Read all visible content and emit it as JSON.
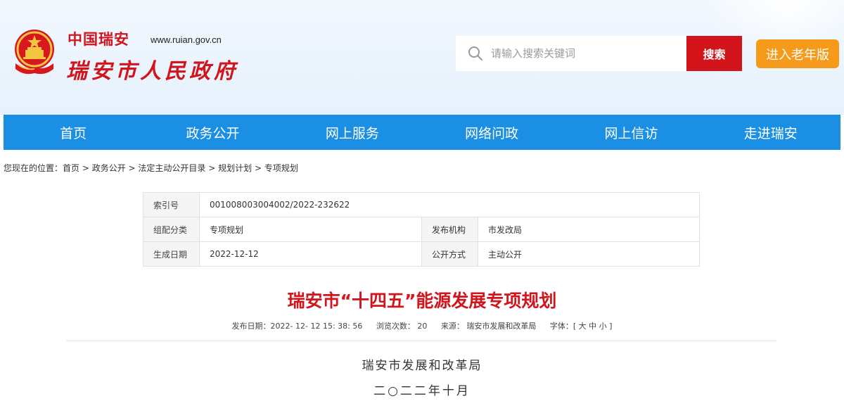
{
  "header": {
    "title_small": "中国瑞安",
    "site_url": "www.ruian.gov.cn",
    "title_big": "瑞安市人民政府",
    "emblem_icon": "national-emblem-icon",
    "colors": {
      "brand_red": "#d1151c",
      "nav_blue": "#1a8fe3",
      "elder_orange": "#f59a1b"
    }
  },
  "search": {
    "placeholder": "请输入搜索关键词",
    "button_label": "搜索"
  },
  "elder_mode_label": "进入老年版",
  "nav": {
    "items": [
      "首页",
      "政务公开",
      "网上服务",
      "网络问政",
      "网上信访",
      "走进瑞安"
    ]
  },
  "breadcrumb": {
    "prefix": "您现在的位置：",
    "items": [
      "首页",
      "政务公开",
      "法定主动公开目录",
      "规划计划",
      "专项规划"
    ],
    "separator": " > "
  },
  "info": {
    "index_label": "索引号",
    "index_value": "001008003004002/2022-232622",
    "category_label": "组配分类",
    "category_value": "专项规划",
    "publisher_label": "发布机构",
    "publisher_value": "市发改局",
    "date_label": "生成日期",
    "date_value": "2022-12-12",
    "disclosure_label": "公开方式",
    "disclosure_value": "主动公开"
  },
  "article": {
    "title": "瑞安市“十四五”能源发展专项规划",
    "meta": {
      "publish_date": "发布日期：2022- 12- 12 15: 38: 56",
      "views": "浏览次数： 20",
      "source": "来源： 瑞安市发展和改革局",
      "font_size": "字体：[ 大 中 小 ]"
    },
    "author": "瑞安市发展和改革局",
    "date": "二○二二年十月"
  }
}
